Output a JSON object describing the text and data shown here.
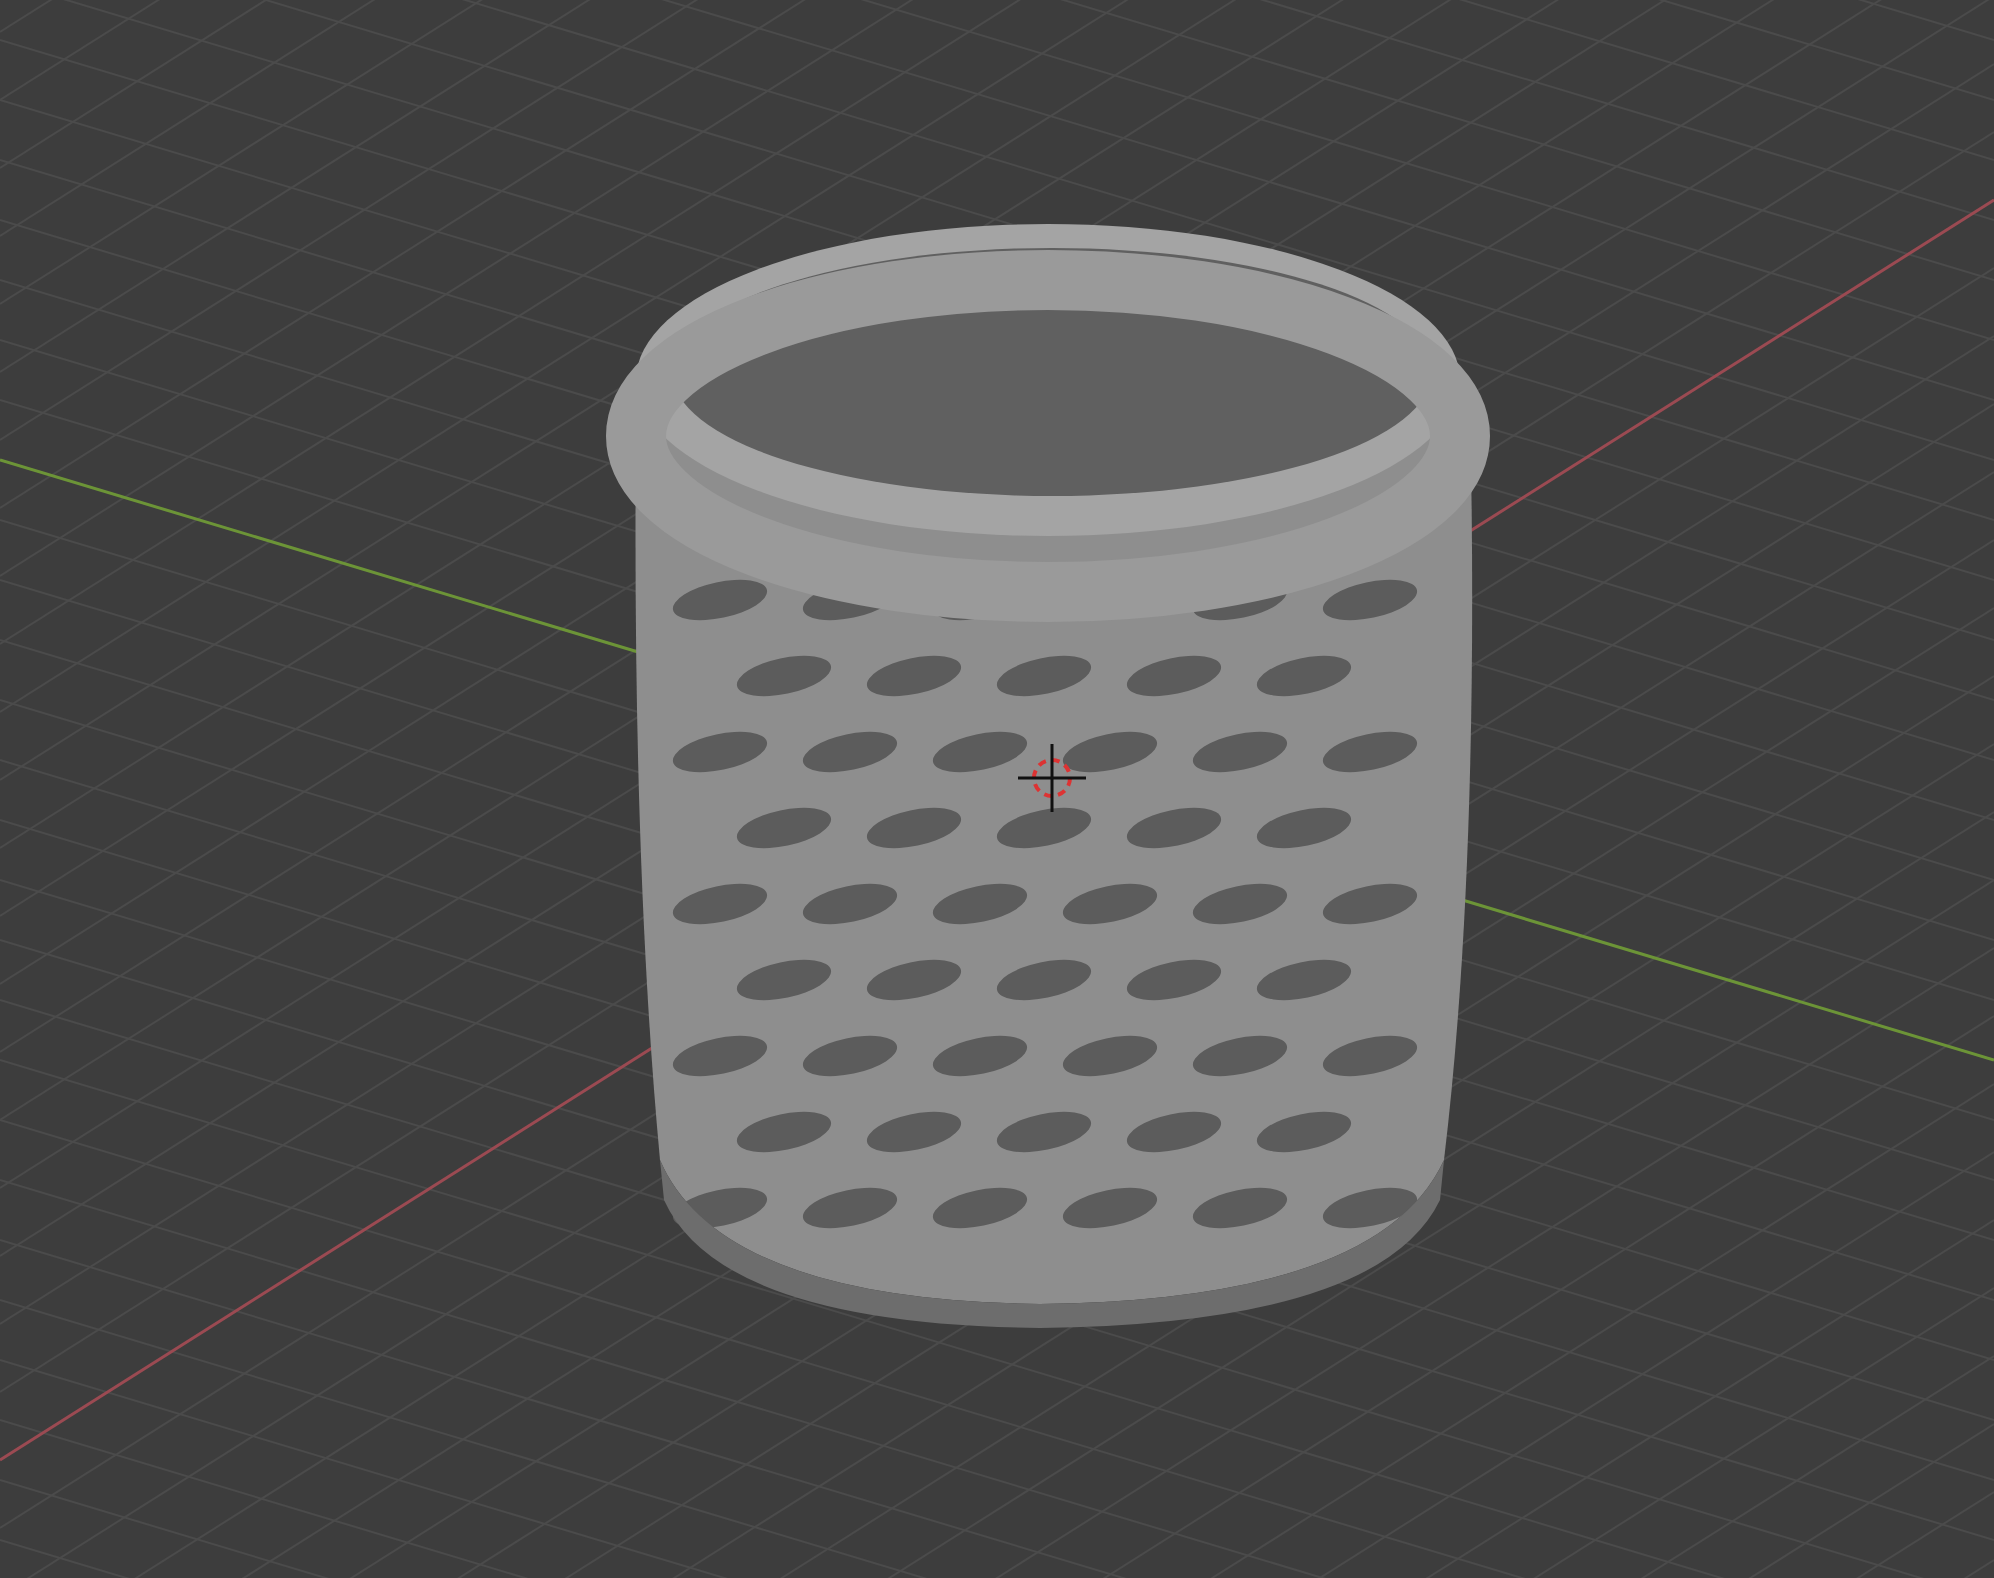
{
  "viewport": {
    "axes": [
      {
        "kind": "x",
        "color": "#9b4a52"
      },
      {
        "kind": "y",
        "color": "#6c9437"
      }
    ],
    "cursor_3d": true
  }
}
